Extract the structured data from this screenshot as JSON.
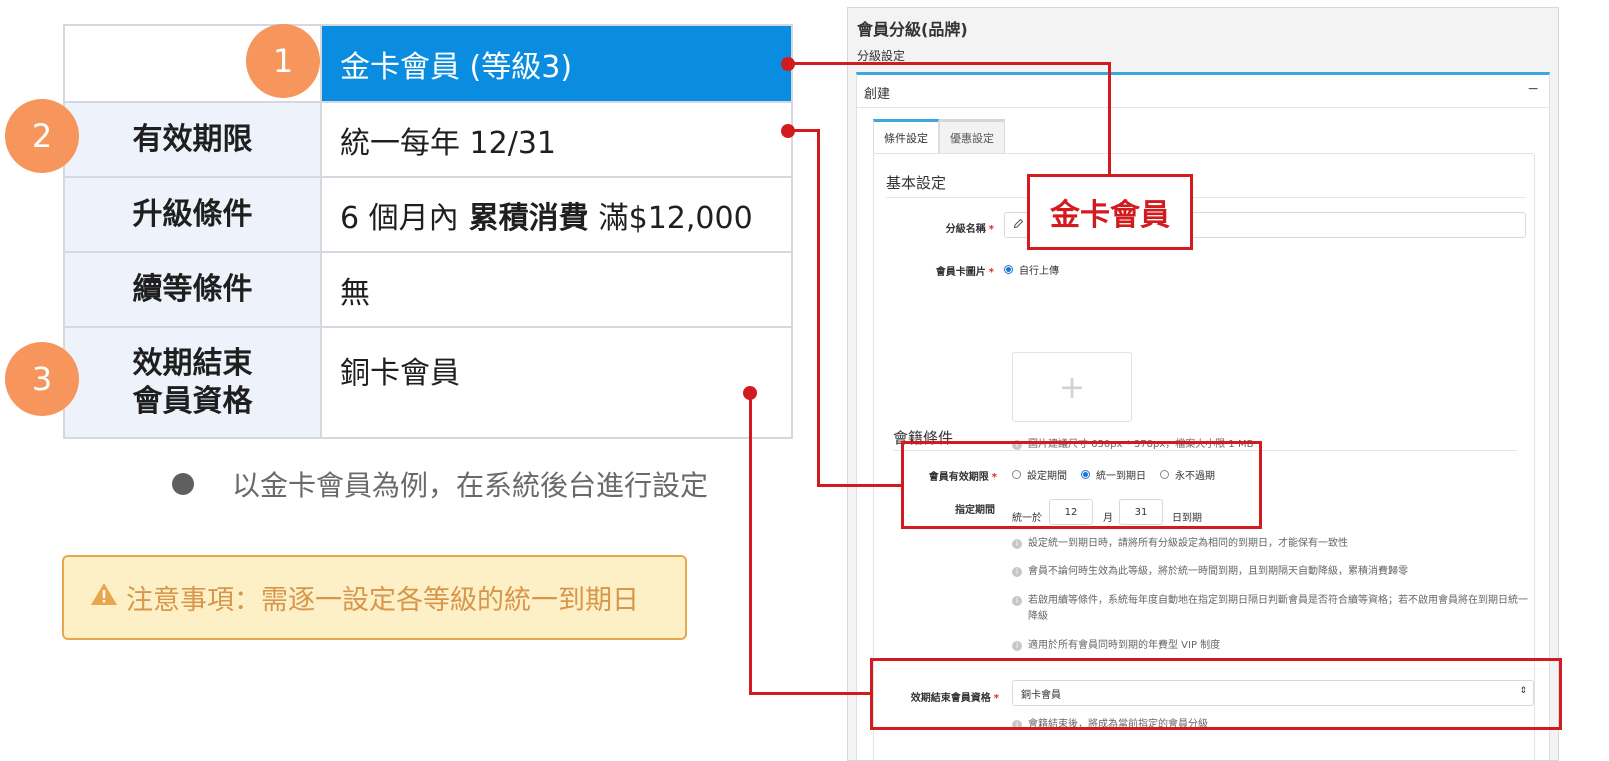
{
  "summary": {
    "badges": [
      "1",
      "2",
      "3"
    ],
    "header_value": "金卡會員 (等級3)",
    "rows": [
      {
        "key": "有效期限",
        "value": "統一每年 12/31"
      },
      {
        "key": "升級條件",
        "value_pre": "6 個月內",
        "value_bold": "累積消費",
        "value_post": "滿$12,000"
      },
      {
        "key": "續等條件",
        "value": "無"
      },
      {
        "key_line1": "效期結束",
        "key_line2": "會員資格",
        "value": "銅卡會員"
      }
    ]
  },
  "bullet": "以金卡會員為例，在系統後台進行設定",
  "notice": {
    "icon": "warning-icon",
    "text": "注意事項：需逐一設定各等級的統一到期日"
  },
  "callout": "金卡會員",
  "panel": {
    "title": "會員分級(品牌)",
    "subtitle": "分級設定",
    "box_title": "創建",
    "collapse": "−",
    "tabs": [
      "條件設定",
      "優惠設定"
    ],
    "basic": {
      "title": "基本設定",
      "name_label": "分級名稱",
      "required": "*",
      "card_label": "會員卡圖片",
      "upload_option": "自行上傳",
      "upload_plus": "+",
      "image_hint": "圖片建議尺寸 650px * 378px，檔案大小限 1 MB"
    },
    "membership": {
      "title": "會籍條件",
      "validity_label": "會員有效期限",
      "options": [
        "設定期間",
        "統一到期日",
        "永不過期"
      ],
      "selected": "統一到期日",
      "period_label": "指定期間",
      "period_prefix": "統一於",
      "month_value": "12",
      "month_unit": "月",
      "day_value": "31",
      "day_unit": "日到期",
      "hints": [
        "設定統一到期日時，請將所有分級設定為相同的到期日，才能保有一致性",
        "會員不論何時生效為此等級，將於統一時間到期，且到期隔天自動降級，累積消費歸零",
        "若啟用續等條件，系統每年度自動地在指定到期日隔日判斷會員是否符合續等資格；若不啟用會員將在到期日統一降級",
        "適用於所有會員同時到期的年費型 VIP 制度"
      ]
    },
    "expiry": {
      "label": "效期結束會員資格",
      "value": "銅卡會員",
      "hint": "會籍結束後，將成為當前指定的會員分級"
    }
  },
  "colors": {
    "accent_blue": "#0a8de0",
    "badge_orange": "#f6955c",
    "annotation_red": "#d21b1f",
    "notice_bg": "#fdf0c6"
  }
}
